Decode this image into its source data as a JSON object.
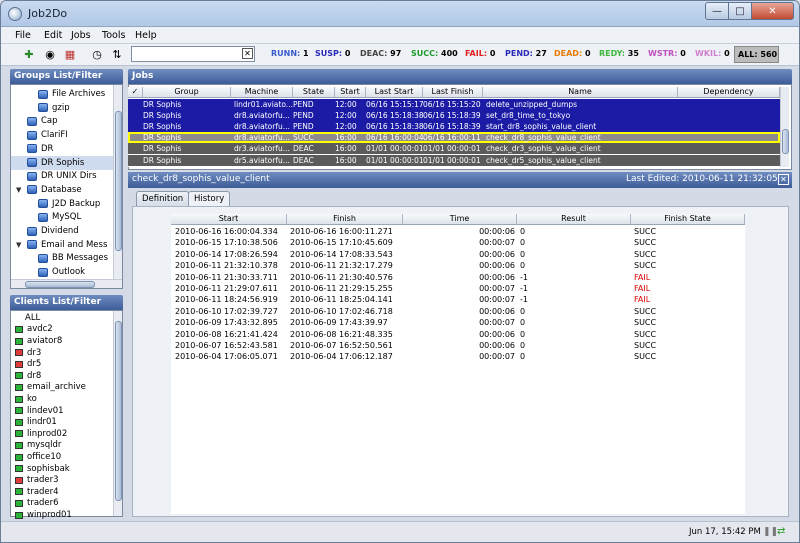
{
  "window": {
    "title": "Job2Do"
  },
  "menu": [
    "File",
    "Edit",
    "Jobs",
    "Tools",
    "Help"
  ],
  "toolbar": {
    "filter_value": "",
    "stats": [
      {
        "label": "RUNN:",
        "value": "1",
        "color": "#3a5bd0"
      },
      {
        "label": "SUSP:",
        "value": "0",
        "color": "#2a2ab8"
      },
      {
        "label": "DEAC:",
        "value": "97",
        "color": "#444444"
      },
      {
        "label": "SUCC:",
        "value": "400",
        "color": "#1d9a2c"
      },
      {
        "label": "FAIL:",
        "value": "0",
        "color": "#e02020"
      },
      {
        "label": "PEND:",
        "value": "27",
        "color": "#2a2ab8"
      },
      {
        "label": "DEAD:",
        "value": "0",
        "color": "#e87a00"
      },
      {
        "label": "REDY:",
        "value": "35",
        "color": "#3db83d"
      },
      {
        "label": "WSTR:",
        "value": "0",
        "color": "#c050c0"
      },
      {
        "label": "WKIL:",
        "value": "0",
        "color": "#d080d0"
      }
    ],
    "all": "ALL: 560"
  },
  "groups": {
    "title": "Groups List/Filter",
    "items": [
      {
        "label": "File Archives",
        "indent": 3,
        "type": "folder"
      },
      {
        "label": "gzip",
        "indent": 3,
        "type": "folder"
      },
      {
        "label": "Cap",
        "indent": 2,
        "type": "folder"
      },
      {
        "label": "ClariFI",
        "indent": 2,
        "type": "folder"
      },
      {
        "label": "DR",
        "indent": 2,
        "type": "folder"
      },
      {
        "label": "DR Sophis",
        "indent": 2,
        "type": "folder",
        "selected": true
      },
      {
        "label": "DR UNIX Dirs",
        "indent": 2,
        "type": "folder"
      },
      {
        "label": "Database",
        "indent": 1,
        "type": "expanded"
      },
      {
        "label": "J2D Backup",
        "indent": 3,
        "type": "folder"
      },
      {
        "label": "MySQL",
        "indent": 3,
        "type": "folder"
      },
      {
        "label": "Dividend",
        "indent": 2,
        "type": "folder"
      },
      {
        "label": "Email and Mess",
        "indent": 1,
        "type": "expanded"
      },
      {
        "label": "BB Messages",
        "indent": 3,
        "type": "folder"
      },
      {
        "label": "Outlook",
        "indent": 3,
        "type": "folder"
      }
    ]
  },
  "clients": {
    "title": "Clients List/Filter",
    "items": [
      {
        "label": "ALL",
        "status": ""
      },
      {
        "label": "avdc2",
        "status": "g"
      },
      {
        "label": "aviator8",
        "status": "g"
      },
      {
        "label": "dr3",
        "status": "r"
      },
      {
        "label": "dr5",
        "status": "r"
      },
      {
        "label": "dr8",
        "status": "g"
      },
      {
        "label": "email_archive",
        "status": "g"
      },
      {
        "label": "ko",
        "status": "g"
      },
      {
        "label": "lindev01",
        "status": "g"
      },
      {
        "label": "lindr01",
        "status": "g"
      },
      {
        "label": "linprod02",
        "status": "g"
      },
      {
        "label": "mysqldr",
        "status": "g"
      },
      {
        "label": "office10",
        "status": "g"
      },
      {
        "label": "sophisbak",
        "status": "g"
      },
      {
        "label": "trader3",
        "status": "r"
      },
      {
        "label": "trader4",
        "status": "g"
      },
      {
        "label": "trader6",
        "status": "g"
      },
      {
        "label": "winprod01",
        "status": "g"
      }
    ]
  },
  "jobs": {
    "title": "Jobs",
    "columns": [
      "Group",
      "Machine",
      "State",
      "Start",
      "Last Start",
      "Last Finish",
      "Name",
      "Dependency"
    ],
    "rows": [
      {
        "group": "DR Sophis",
        "machine": "lindr01.aviato...",
        "state": "PEND",
        "start": "12:00",
        "last_start": "06/16 15:15:17",
        "last_finish": "06/16 15:15:20",
        "name": "delete_unzipped_dumps",
        "dep": "",
        "style": "blue"
      },
      {
        "group": "DR Sophis",
        "machine": "dr8.aviatorfu...",
        "state": "PEND",
        "start": "12:00",
        "last_start": "06/16 15:18:38",
        "last_finish": "06/16 15:18:39",
        "name": "set_dr8_time_to_tokyo",
        "dep": "",
        "style": "blue"
      },
      {
        "group": "DR Sophis",
        "machine": "dr8.aviatorfu...",
        "state": "PEND",
        "start": "12:00",
        "last_start": "06/16 15:18:38",
        "last_finish": "06/16 15:18:39",
        "name": "start_dr8_sophis_value_client",
        "dep": "",
        "style": "blue"
      },
      {
        "group": "DR Sophis",
        "machine": "dr8.aviatorfu...",
        "state": "SUCC",
        "start": "16:00",
        "last_start": "06/16 16:00:04",
        "last_finish": "06/16 16:00:11",
        "name": "check_dr8_sophis_value_client",
        "dep": "",
        "style": "sel"
      },
      {
        "group": "DR Sophis",
        "machine": "dr3.aviatorfu...",
        "state": "DEAC",
        "start": "16:00",
        "last_start": "01/01 00:00:01",
        "last_finish": "01/01 00:00:01",
        "name": "check_dr3_sophis_value_client",
        "dep": "",
        "style": "grey"
      },
      {
        "group": "DR Sophis",
        "machine": "dr5.aviatorfu...",
        "state": "DEAC",
        "start": "16:00",
        "last_start": "01/01 00:00:01",
        "last_finish": "01/01 00:00:01",
        "name": "check_dr5_sophis_value_client",
        "dep": "",
        "style": "grey"
      }
    ]
  },
  "detail": {
    "title": "check_dr8_sophis_value_client",
    "last_edited": "Last Edited:   2010-06-11 21:32:05",
    "tabs": [
      "Definition",
      "History"
    ]
  },
  "history": {
    "columns": [
      "Start",
      "Finish",
      "Time",
      "Result",
      "Finish State"
    ],
    "rows": [
      [
        "2010-06-16 16:00:04.334",
        "2010-06-16 16:00:11.271",
        "00:00:06",
        "0",
        "SUCC"
      ],
      [
        "2010-06-15 17:10:38.506",
        "2010-06-15 17:10:45.609",
        "00:00:07",
        "0",
        "SUCC"
      ],
      [
        "2010-06-14 17:08:26.594",
        "2010-06-14 17:08:33.543",
        "00:00:06",
        "0",
        "SUCC"
      ],
      [
        "2010-06-11 21:32:10.378",
        "2010-06-11 21:32:17.279",
        "00:00:06",
        "0",
        "SUCC"
      ],
      [
        "2010-06-11 21:30:33.711",
        "2010-06-11 21:30:40.576",
        "00:00:06",
        "-1",
        "FAIL"
      ],
      [
        "2010-06-11 21:29:07.611",
        "2010-06-11 21:29:15.255",
        "00:00:07",
        "-1",
        "FAIL"
      ],
      [
        "2010-06-11 18:24:56.919",
        "2010-06-11 18:25:04.141",
        "00:00:07",
        "-1",
        "FAIL"
      ],
      [
        "2010-06-10 17:02:39.727",
        "2010-06-10 17:02:46.718",
        "00:00:06",
        "0",
        "SUCC"
      ],
      [
        "2010-06-09 17:43:32.895",
        "2010-06-09 17:43:39.97",
        "00:00:07",
        "0",
        "SUCC"
      ],
      [
        "2010-06-08 16:21:41.424",
        "2010-06-08 16:21:48.335",
        "00:00:06",
        "0",
        "SUCC"
      ],
      [
        "2010-06-07 16:52:43.581",
        "2010-06-07 16:52:50.561",
        "00:00:06",
        "0",
        "SUCC"
      ],
      [
        "2010-06-04 17:06:05.071",
        "2010-06-04 17:06:12.187",
        "00:00:07",
        "0",
        "SUCC"
      ]
    ]
  },
  "status": {
    "time": "Jun 17, 15:42 PM"
  }
}
